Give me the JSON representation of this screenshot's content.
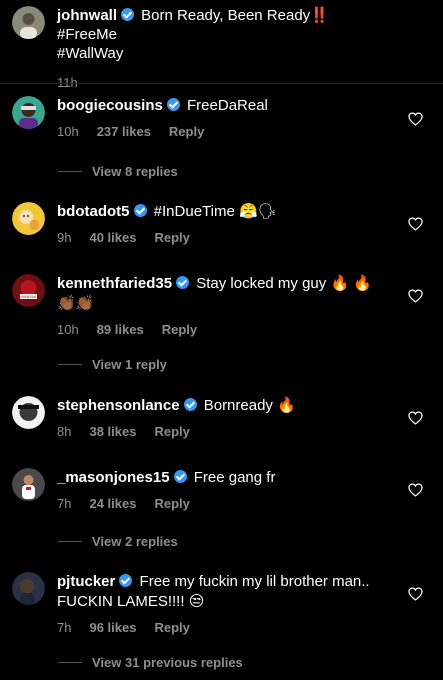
{
  "caption": {
    "username": "johnwall",
    "text_line1": "Born Ready, Been Ready",
    "text_icon": "‼️",
    "text_tag1": "#FreeMe",
    "text_tag2": "#WallWay",
    "time": "11h"
  },
  "comments": [
    {
      "username": "boogiecousins",
      "verified": true,
      "text": "FreeDaReal",
      "time": "10h",
      "likes": "237 likes",
      "reply": "Reply",
      "view_replies": "View 8 replies"
    },
    {
      "username": "bdotadot5",
      "verified": true,
      "text": "#InDueTime",
      "emoji": "😤🗣",
      "time": "9h",
      "likes": "40 likes",
      "reply": "Reply"
    },
    {
      "username": "kennethfaried35",
      "verified": true,
      "text": "Stay locked my guy",
      "emoji": "🔥 🔥",
      "emoji_line2": "👏🏾👏🏾",
      "time": "10h",
      "likes": "89 likes",
      "reply": "Reply",
      "view_replies": "View 1 reply"
    },
    {
      "username": "stephensonlance",
      "verified": true,
      "text": "Bornready",
      "emoji": "🔥",
      "time": "8h",
      "likes": "38 likes",
      "reply": "Reply"
    },
    {
      "username": "_masonjones15",
      "verified": true,
      "text": "Free gang fr",
      "time": "7h",
      "likes": "24 likes",
      "reply": "Reply",
      "view_replies": "View 2 replies"
    },
    {
      "username": "pjtucker",
      "verified": true,
      "text": "Free my fuckin my lil brother man..",
      "text_line2": "FUCKIN LAMES!!!!",
      "emoji": "😒",
      "time": "7h",
      "likes": "96 likes",
      "reply": "Reply",
      "view_replies": "View 31 previous replies"
    }
  ],
  "colors": {
    "background": "#000000",
    "text": "#ffffff",
    "muted": "#8e8e8e",
    "verified": "#3897f0"
  },
  "icons": {
    "heart": "heart-outline-icon",
    "verified": "verified-badge-icon"
  }
}
